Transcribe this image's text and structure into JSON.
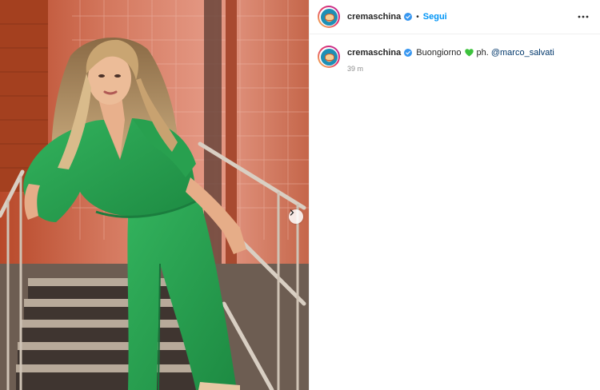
{
  "post": {
    "username": "cremaschina",
    "follow_label": "Segui",
    "separator": "•",
    "caption_prefix": "Buongiorno",
    "caption_emoji": "green-heart",
    "caption_suffix": "ph.",
    "mention": "@marco_salvati",
    "time": "39 m"
  },
  "icons": {
    "verified": "verified-badge-icon",
    "more": "more-options-icon",
    "next": "chevron-right-icon"
  },
  "colors": {
    "link_blue": "#0095f6",
    "mention_blue": "#00376b",
    "verified_blue": "#3897f0",
    "dress_green": "#27a24f"
  }
}
